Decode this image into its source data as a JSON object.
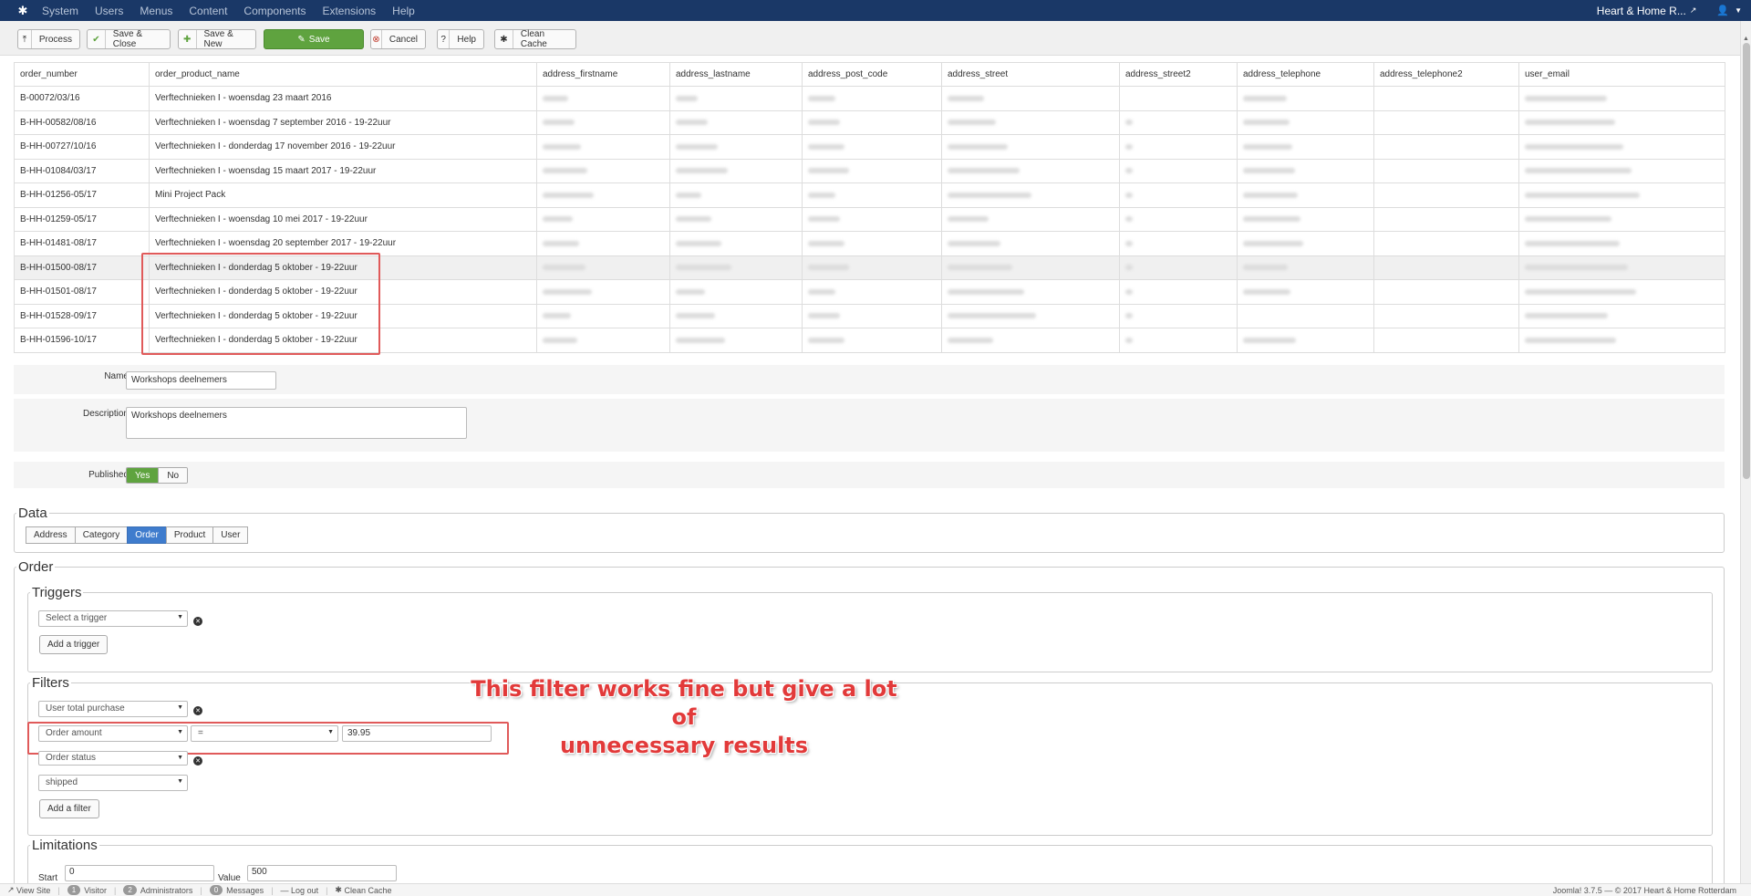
{
  "topnav": {
    "menu": [
      "System",
      "Users",
      "Menus",
      "Content",
      "Components",
      "Extensions",
      "Help"
    ],
    "site_name": "Heart & Home R..."
  },
  "toolbar": {
    "process": "Process",
    "save_close": "Save & Close",
    "save_new": "Save & New",
    "save": "Save",
    "cancel": "Cancel",
    "help": "Help",
    "clean_cache": "Clean Cache"
  },
  "table": {
    "headers": [
      "order_number",
      "order_product_name",
      "address_firstname",
      "address_lastname",
      "address_post_code",
      "address_street",
      "address_street2",
      "address_telephone",
      "address_telephone2",
      "user_email"
    ],
    "rows": [
      {
        "order_number": "B-00072/03/16",
        "product": "Verftechnieken I - woensdag 23 maart 2016"
      },
      {
        "order_number": "B-HH-00582/08/16",
        "product": "Verftechnieken I - woensdag 7 september 2016 - 19-22uur"
      },
      {
        "order_number": "B-HH-00727/10/16",
        "product": "Verftechnieken I - donderdag 17 november 2016 - 19-22uur"
      },
      {
        "order_number": "B-HH-01084/03/17",
        "product": "Verftechnieken I - woensdag 15 maart 2017 - 19-22uur"
      },
      {
        "order_number": "B-HH-01256-05/17",
        "product": "Mini Project Pack"
      },
      {
        "order_number": "B-HH-01259-05/17",
        "product": "Verftechnieken I - woensdag 10 mei 2017 - 19-22uur"
      },
      {
        "order_number": "B-HH-01481-08/17",
        "product": "Verftechnieken I - woensdag 20 september 2017 - 19-22uur"
      },
      {
        "order_number": "B-HH-01500-08/17",
        "product": "Verftechnieken I - donderdag 5 oktober - 19-22uur"
      },
      {
        "order_number": "B-HH-01501-08/17",
        "product": "Verftechnieken I - donderdag 5 oktober - 19-22uur"
      },
      {
        "order_number": "B-HH-01528-09/17",
        "product": "Verftechnieken I - donderdag 5 oktober - 19-22uur"
      },
      {
        "order_number": "B-HH-01596-10/17",
        "product": "Verftechnieken I - donderdag 5 oktober - 19-22uur"
      }
    ]
  },
  "form": {
    "name_label": "Name",
    "name_value": "Workshops deelnemers",
    "description_label": "Description",
    "description_value": "Workshops deelnemers",
    "published_label": "Published",
    "yes": "Yes",
    "no": "No"
  },
  "data_section": {
    "legend": "Data",
    "tabs": [
      "Address",
      "Category",
      "Order",
      "Product",
      "User"
    ],
    "active_tab": "Order"
  },
  "order_section": {
    "legend": "Order",
    "triggers": {
      "legend": "Triggers",
      "select_placeholder": "Select a trigger",
      "add_button": "Add a trigger"
    },
    "filters": {
      "legend": "Filters",
      "filter1": "User total purchase",
      "filter2_field": "Order amount",
      "filter2_operator": "=",
      "filter2_value": "39.95",
      "filter3": "Order status",
      "filter3_value": "shipped",
      "add_button": "Add a filter"
    },
    "limitations": {
      "legend": "Limitations",
      "start_label": "Start",
      "start_value": "0",
      "value_label": "Value",
      "value_value": "500"
    }
  },
  "annotation": {
    "line1": "This filter works fine but give a lot of",
    "line2": "unnecessary results",
    "color": "#e23a3a"
  },
  "statusbar": {
    "view_site": "View Site",
    "visitor_count": "1",
    "visitor": "Visitor",
    "admin_count": "2",
    "administrators": "Administrators",
    "messages_count": "0",
    "messages": "Messages",
    "logout": "Log out",
    "clean_cache": "Clean Cache",
    "footer": "Joomla! 3.7.5  —  © 2017 Heart & Home Rotterdam"
  }
}
